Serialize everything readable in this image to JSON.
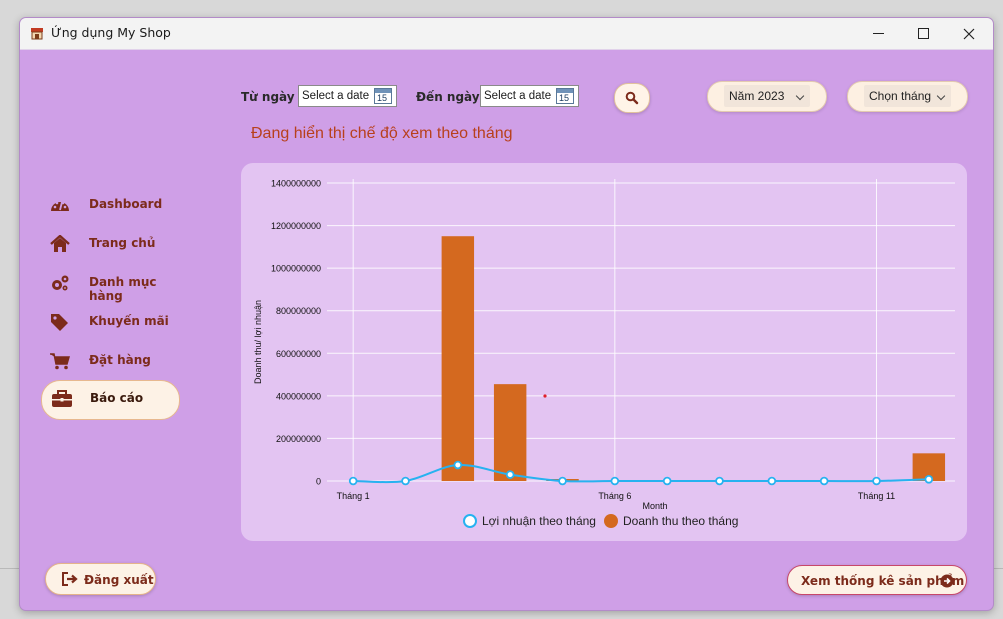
{
  "window": {
    "title": "Ứng dụng My Shop"
  },
  "filters": {
    "from_label": "Từ ngày",
    "from_placeholder": "Select a date",
    "to_label": "Đến ngày",
    "to_placeholder": "Select a date",
    "calendar_day": "15",
    "year_selected": "Năm 2023",
    "month_selected": "Chọn tháng"
  },
  "mode_text": "Đang hiển thị chế độ xem theo tháng",
  "sidebar": {
    "items": [
      {
        "label": "Dashboard",
        "icon": "dashboard-icon"
      },
      {
        "label": "Trang chủ",
        "icon": "home-icon"
      },
      {
        "label": "Danh mục hàng",
        "icon": "gears-icon"
      },
      {
        "label": "Khuyến mãi",
        "icon": "tags-icon"
      },
      {
        "label": "Đặt hàng",
        "icon": "cart-icon"
      },
      {
        "label": "Báo cáo",
        "icon": "briefcase-icon",
        "active": true
      }
    ]
  },
  "buttons": {
    "logout": "Đăng xuất",
    "product_stats": "Xem thống kê sản phẩm"
  },
  "colors": {
    "accent": "#d4691f",
    "line": "#27b2f0",
    "text_brown": "#7c2b1b",
    "window_bg": "#cf9fe7"
  },
  "chart_data": {
    "type": "bar",
    "x": [
      1,
      2,
      3,
      4,
      5,
      6,
      7,
      8,
      9,
      10,
      11,
      12
    ],
    "x_ticks": [
      1,
      6,
      11
    ],
    "x_tick_labels": [
      "Tháng 1",
      "Tháng 6",
      "Tháng 11"
    ],
    "xlabel": "Month",
    "ylabel": "Doanh thu/ lợi nhuận",
    "ylim": [
      0,
      1400000000
    ],
    "y_ticks": [
      0,
      200000000,
      400000000,
      600000000,
      800000000,
      1000000000,
      1200000000,
      1400000000
    ],
    "grid": true,
    "legend_position": "bottom",
    "series": [
      {
        "name": "Doanh thu theo tháng",
        "type": "bar",
        "color": "#d4691f",
        "values": [
          0,
          0,
          1150000000,
          455000000,
          0,
          0,
          0,
          0,
          0,
          0,
          0,
          130000000
        ]
      },
      {
        "name": "Lợi nhuận theo tháng",
        "type": "line",
        "color": "#27b2f0",
        "values": [
          0,
          0,
          75000000,
          30000000,
          0,
          0,
          0,
          0,
          0,
          0,
          0,
          8000000
        ]
      }
    ],
    "annotations": [
      {
        "type": "bar",
        "x": 5,
        "value": 5000000
      }
    ]
  }
}
